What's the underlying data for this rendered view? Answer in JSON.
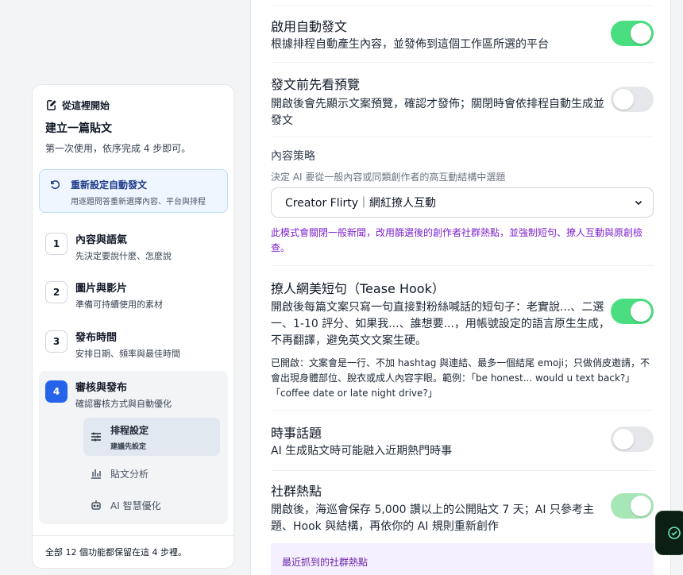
{
  "colors": {
    "accent": "#2563eb",
    "toggle_on": "#4ade80",
    "purple": "#7e22ce"
  },
  "sidebar": {
    "start_label": "從這裡開始",
    "title": "建立一篇貼文",
    "subtitle": "第一次使用，依序完成 4 步即可。",
    "reset": {
      "title": "重新設定自動發文",
      "desc": "用逐題問答重新選擇內容、平台與排程"
    },
    "steps": [
      {
        "num": "1",
        "title": "內容與語氣",
        "desc": "先決定要說什麼、怎麼說"
      },
      {
        "num": "2",
        "title": "圖片與影片",
        "desc": "準備可持續使用的素材"
      },
      {
        "num": "3",
        "title": "發布時間",
        "desc": "安排日期、頻率與最佳時間"
      },
      {
        "num": "4",
        "title": "審核與發布",
        "desc": "確認審核方式與自動優化"
      }
    ],
    "subitems": [
      {
        "title": "排程設定",
        "sub": "建議先設定"
      },
      {
        "title": "貼文分析"
      },
      {
        "title": "AI 智慧優化"
      }
    ],
    "footer": "全部 12 個功能都保留在這 4 步裡。"
  },
  "settings": {
    "auto_post": {
      "title": "啟用自動發文",
      "desc": "根據排程自動產生內容，並發佈到這個工作區所選的平台",
      "state": "on"
    },
    "preview": {
      "title": "發文前先看預覽",
      "desc": "開啟後會先顯示文案預覽，確認才發佈；關閉時會依排程自動生成並發文",
      "state": "off"
    },
    "strategy": {
      "label": "內容策略",
      "sub": "決定 AI 要從一般內容或同類創作者的高互動結構中選題",
      "selected": "Creator Flirty｜網紅撩人互動",
      "note": "此模式會關閉一般新聞，改用篩選後的創作者社群熱點，並強制短句、撩人互動與原創檢查。"
    },
    "tease": {
      "title": "撩人網美短句（Tease Hook）",
      "desc": "開啟後每篇文案只寫一句直接對粉絲喊話的短句子：老實說...、二選一、1-10 評分、如果我...、誰想要...，用帳號設定的語言原生生成，不再翻譯，避免英文文案生硬。",
      "note": "已開啟：文案會是一行、不加 hashtag 與連結、最多一個結尾 emoji；只做俏皮邀請，不會出現身體部位、脫衣或成人內容字眼。範例：「be honest... would u text back?」「coffee date or late night drive?」",
      "state": "on"
    },
    "news": {
      "title": "時事話題",
      "desc": "AI 生成貼文時可能融入近期熱門時事",
      "state": "off"
    },
    "hot": {
      "title": "社群熱點",
      "desc": "開啟後，海巡會保存 5,000 讚以上的公開貼文 7 天；AI 只參考主題、Hook 與結構，再依你的 AI 規則重新創作",
      "state": "on"
    },
    "recent_label": "最近抓到的社群熱點"
  }
}
